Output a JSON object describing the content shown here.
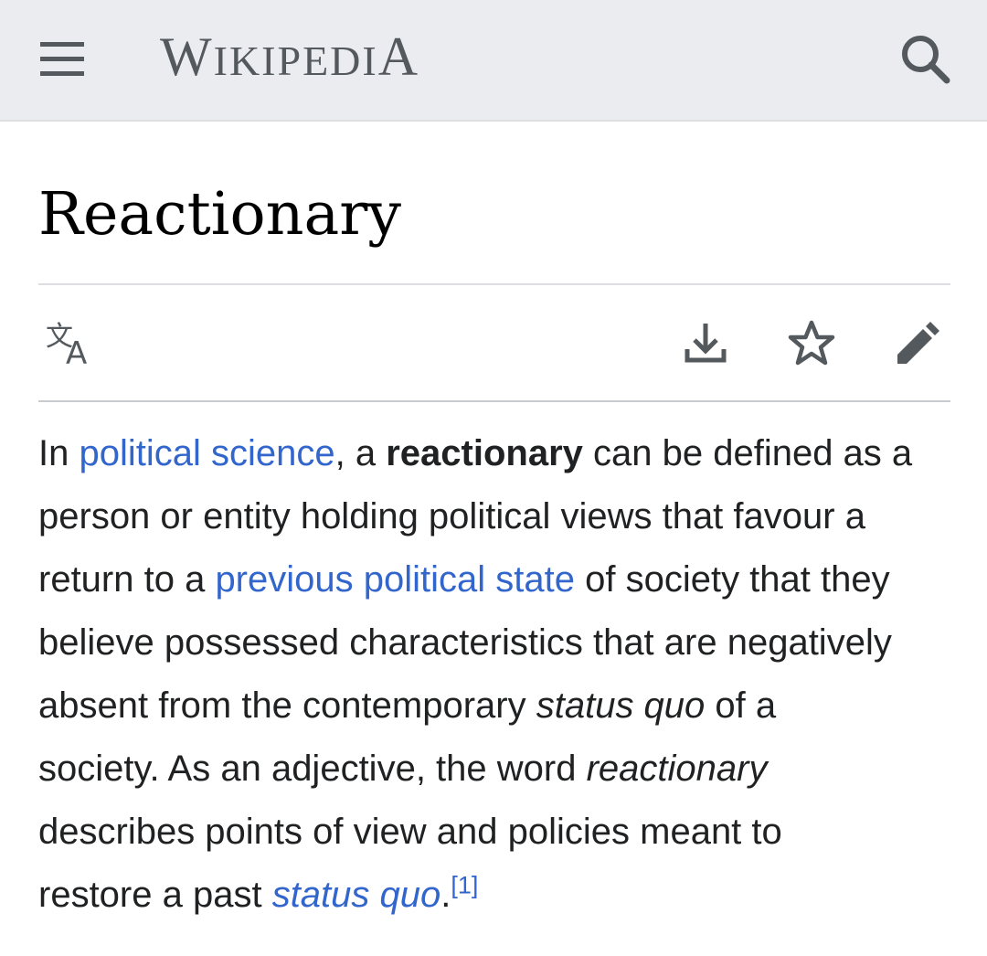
{
  "header": {
    "wordmark": {
      "W": "W",
      "IKIPEDI": "IKIPEDI",
      "A": "A"
    },
    "menu_icon": "hamburger-menu-icon",
    "search_icon": "search-icon",
    "background": "#eaecf0"
  },
  "article": {
    "title": "Reactionary",
    "actions": {
      "language_icon": "language-icon",
      "download_icon": "download-icon",
      "watch_icon": "star-icon",
      "edit_icon": "pencil-icon"
    },
    "lead": {
      "l1_a": "In ",
      "l1_link": "political science",
      "l1_b": ", a ",
      "l1_bold": "reactionary",
      "l1_c": " can be defined as a",
      "l2": "person or entity holding political views that favour a",
      "l3_a": "return to a ",
      "l3_link": "previous political state",
      "l3_b": " of society that they",
      "l4": "believe possessed characteristics that are negatively",
      "l5_a": "absent from the contemporary ",
      "l5_italic": "status quo",
      "l5_b": " of a",
      "l6_a": "society. As an adjective, the word ",
      "l6_italic": "reactionary",
      "l7": "describes points of view and policies meant to",
      "l8_a": "restore a past ",
      "l8_link": "status quo",
      "l8_b": ".",
      "l8_ref": "[1]"
    }
  },
  "colors": {
    "link": "#3366cc",
    "text": "#202122",
    "icon": "#54595d",
    "divider": "#c8ccd1"
  }
}
